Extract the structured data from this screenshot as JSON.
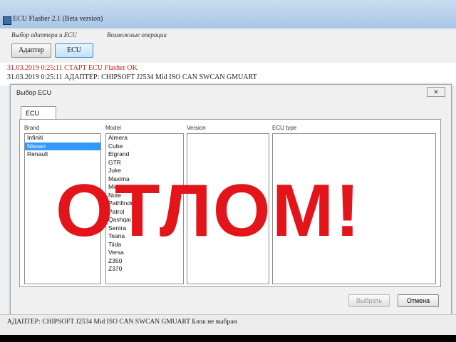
{
  "window": {
    "title": "ECU Flasher 2.1 (Beta version)"
  },
  "toolbar": {
    "adapter_section_label": "Выбор адаптера и ECU",
    "operations_label": "Возможные операции",
    "adapter_button": "Адаптер",
    "ecu_button": "ECU"
  },
  "log": {
    "line1": "31.03.2019 0:25:11 СТАРТ ECU Flasher OK",
    "line2": "31.03.2019 0:25:11 АДАПТЕР: CHIPSOFT J2534 Mid ISO CAN SWCAN GMUART"
  },
  "dialog": {
    "title": "Выбор ECU",
    "close_icon": "close-icon",
    "tab": "ECU",
    "columns": {
      "brand": "Brand",
      "model": "Model",
      "version": "Version",
      "ecu_type": "ECU type"
    },
    "brands": [
      "Infiniti",
      "Nissan",
      "Renault"
    ],
    "selected_brand": "Nissan",
    "models": [
      "Almera",
      "Cube",
      "Elgrand",
      "GTR",
      "Juke",
      "Maxima",
      "Micra",
      "Note",
      "Pathfinder",
      "Patrol",
      "Qashqai",
      "Sentra",
      "Teana",
      "Tiida",
      "Versa",
      "Z350",
      "Z370"
    ],
    "select_button": "Выбрать",
    "cancel_button": "Отмена"
  },
  "statusbar": {
    "text": "АДАПТЕР: CHIPSOFT J2534 Mid ISO CAN SWCAN GMUART   Блок не выбран"
  },
  "overlay": {
    "text": "ОТЛОМ!"
  },
  "colors": {
    "overlay": "#e4141b",
    "selection": "#3399ff",
    "log_red": "#c01818"
  }
}
